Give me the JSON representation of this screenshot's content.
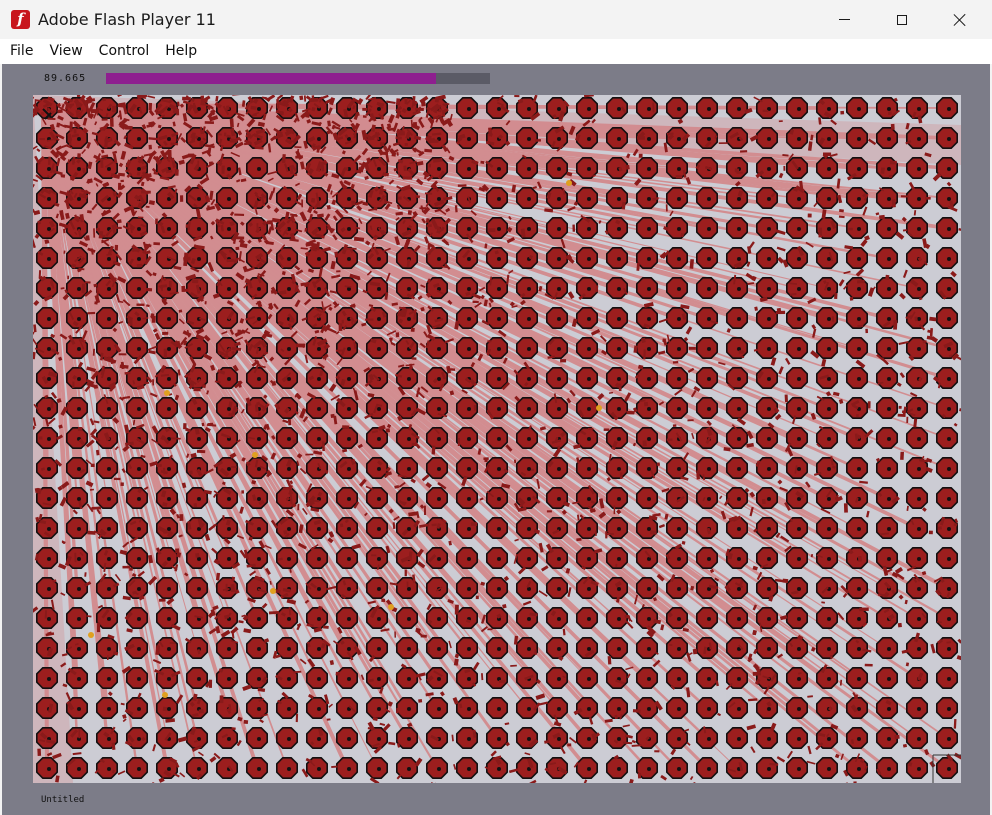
{
  "window": {
    "title": "Adobe Flash Player 11",
    "icon": "flash-player-icon",
    "controls": [
      "minimize-icon",
      "maximize-icon",
      "close-icon"
    ]
  },
  "menu": {
    "items": [
      "File",
      "View",
      "Control",
      "Help"
    ]
  },
  "stage": {
    "fps": "89.665",
    "progress_fraction": 0.86,
    "bottom_label": "Untitled",
    "colors": {
      "stage_bg": "#7c7c88",
      "arena_bg": "#ccccd4",
      "enemy_fill": "#9c1e1e",
      "beam": "#d85a5a",
      "shard": "#8a1a1a",
      "progress": "#8e1f8f"
    }
  }
}
